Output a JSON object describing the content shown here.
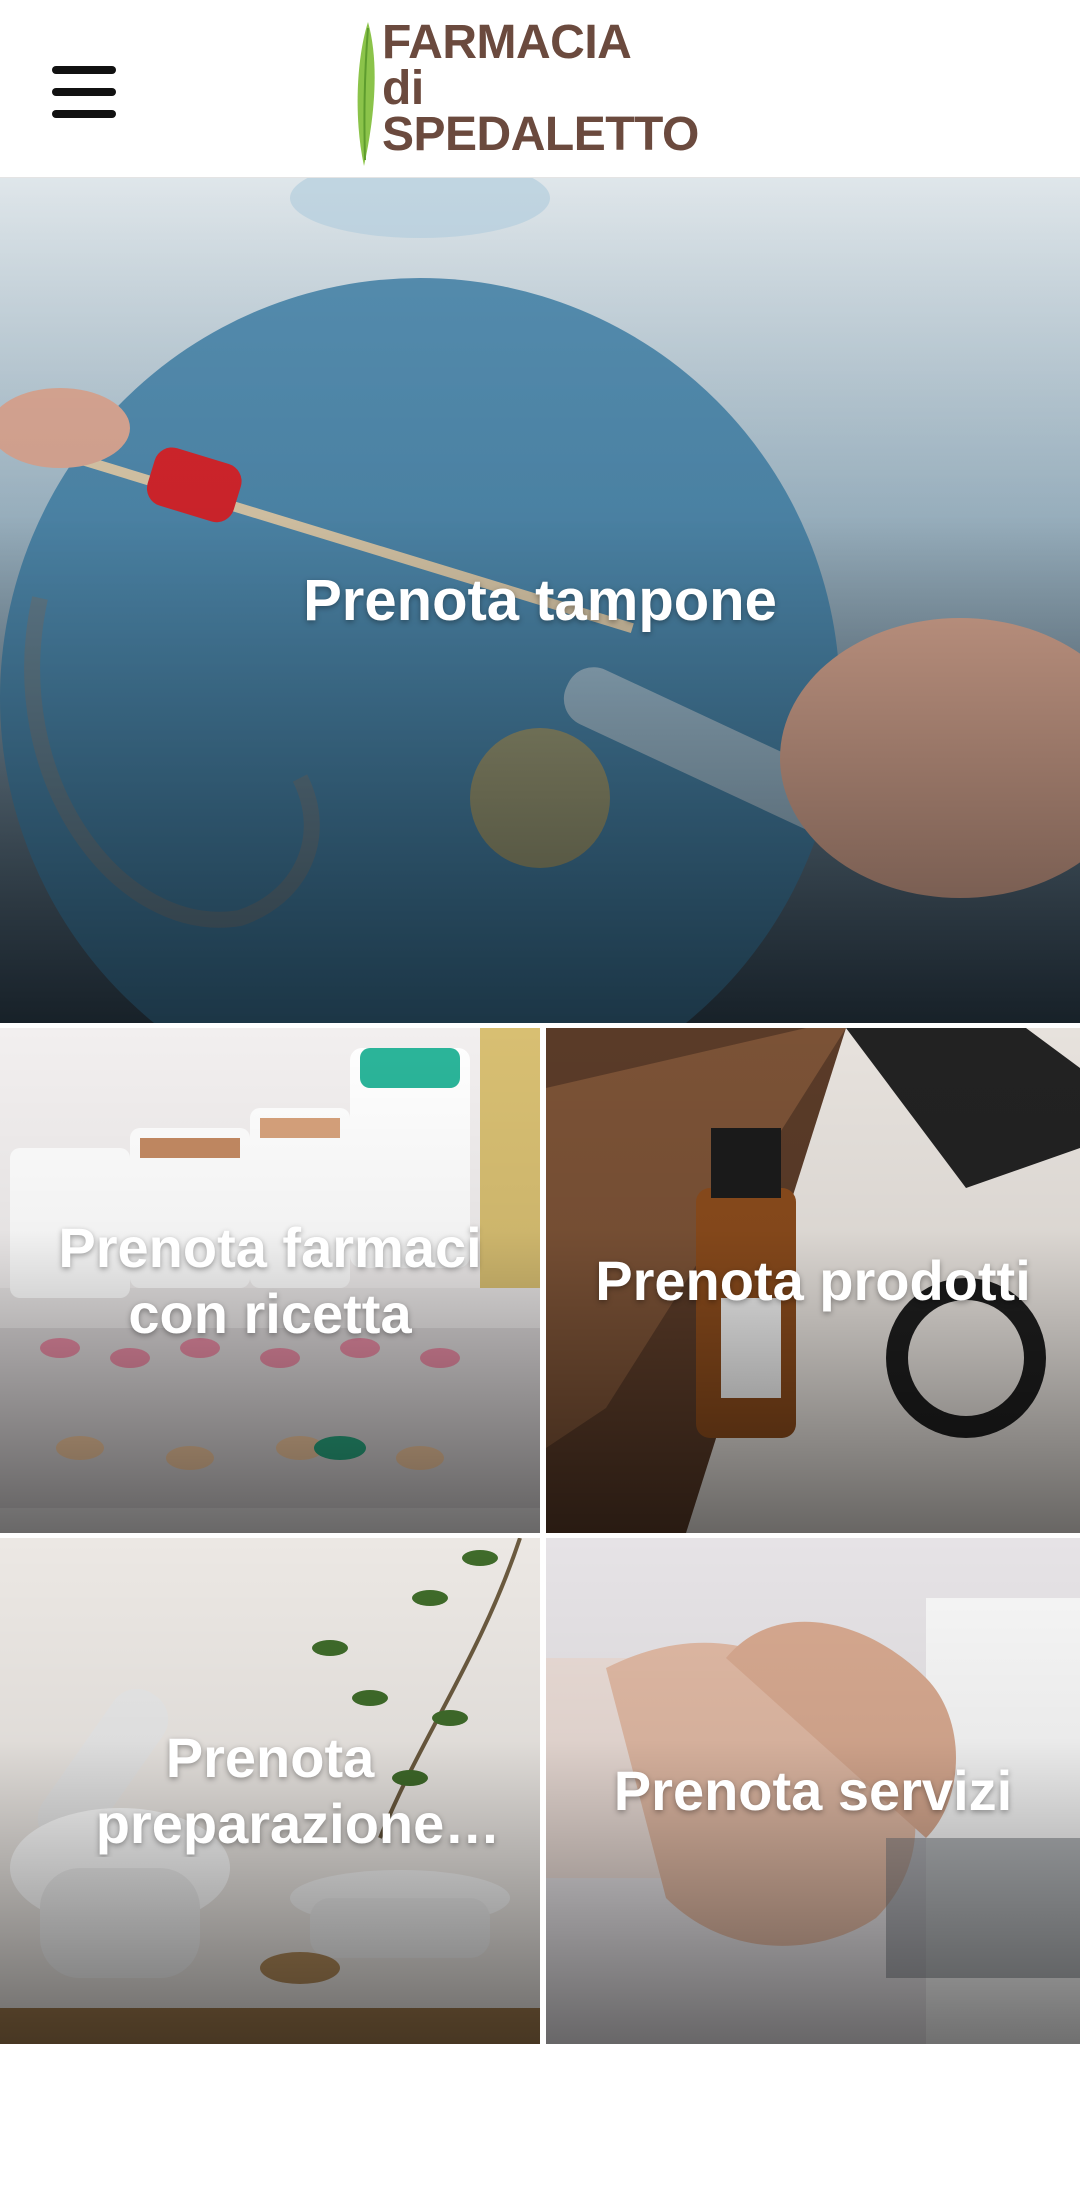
{
  "header": {
    "menu_icon": "hamburger-menu-icon",
    "logo": {
      "line1": "FARMACIA",
      "line2": "di",
      "line3": "SPEDALETTO",
      "text_color": "#6b4a3e",
      "leaf_color": "#8bc34a"
    }
  },
  "tiles": {
    "hero": {
      "label": "Prenota tampone"
    },
    "farmaci": {
      "label": "Prenota farmaci con ricetta"
    },
    "prodotti": {
      "label": "Prenota prodotti"
    },
    "preparazione": {
      "label": "Prenota preparazione galenica"
    },
    "servizi": {
      "label": "Prenota servizi"
    }
  }
}
